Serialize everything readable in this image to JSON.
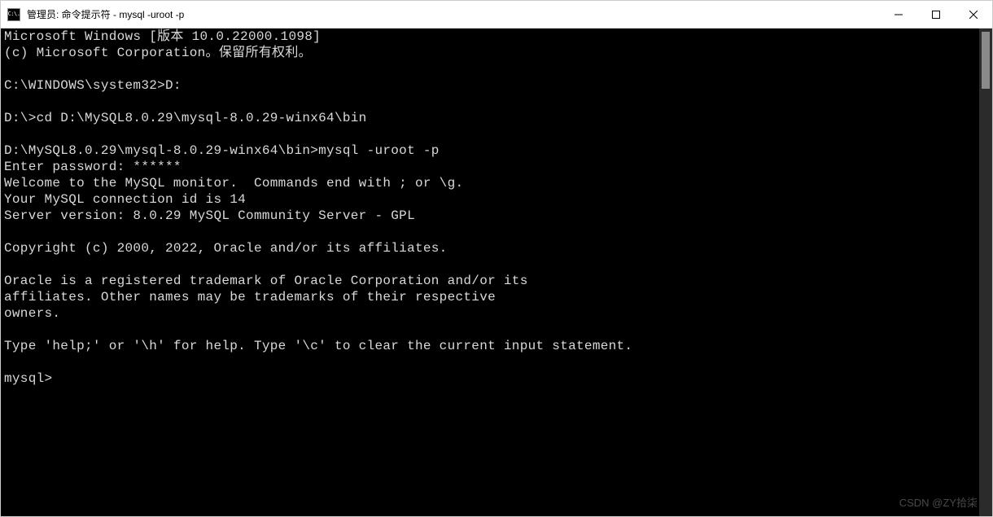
{
  "window": {
    "icon_text": "C:\\.",
    "title": "管理员: 命令提示符 - mysql  -uroot -p"
  },
  "terminal": {
    "lines": [
      "Microsoft Windows [版本 10.0.22000.1098]",
      "(c) Microsoft Corporation。保留所有权利。",
      "",
      "C:\\WINDOWS\\system32>D:",
      "",
      "D:\\>cd D:\\MySQL8.0.29\\mysql-8.0.29-winx64\\bin",
      "",
      "D:\\MySQL8.0.29\\mysql-8.0.29-winx64\\bin>mysql -uroot -p",
      "Enter password: ******",
      "Welcome to the MySQL monitor.  Commands end with ; or \\g.",
      "Your MySQL connection id is 14",
      "Server version: 8.0.29 MySQL Community Server - GPL",
      "",
      "Copyright (c) 2000, 2022, Oracle and/or its affiliates.",
      "",
      "Oracle is a registered trademark of Oracle Corporation and/or its",
      "affiliates. Other names may be trademarks of their respective",
      "owners.",
      "",
      "Type 'help;' or '\\h' for help. Type '\\c' to clear the current input statement.",
      "",
      "mysql>"
    ]
  },
  "watermark": "CSDN @ZY拾柒"
}
